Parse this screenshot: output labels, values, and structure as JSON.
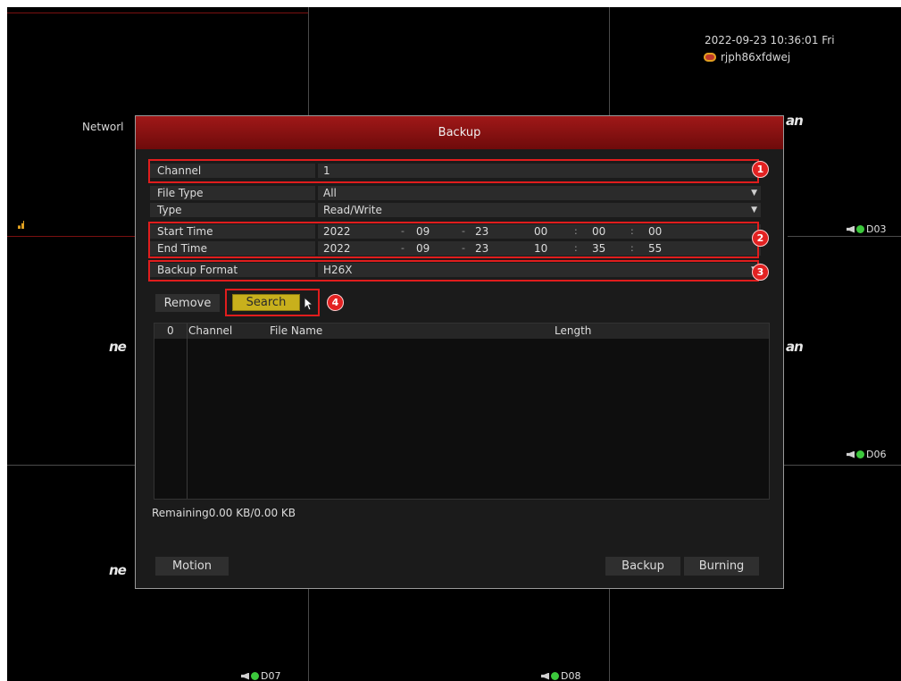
{
  "overlay": {
    "datetime": "2022-09-23 10:36:01 Fri",
    "device_id": "rjph86xfdwej"
  },
  "cameras": {
    "network_text": "Networl",
    "logo_text": "ne",
    "logo_text_right": "an",
    "channel_d03": "D03",
    "channel_d06": "D06",
    "channel_d07": "D07",
    "channel_d08": "D08"
  },
  "dialog": {
    "title": "Backup",
    "fields": {
      "channel": {
        "label": "Channel",
        "value": "1"
      },
      "file_type": {
        "label": "File Type",
        "value": "All"
      },
      "type": {
        "label": "Type",
        "value": "Read/Write"
      },
      "start_time": {
        "label": "Start Time",
        "year": "2022",
        "month": "09",
        "day": "23",
        "hour": "00",
        "minute": "00",
        "second": "00"
      },
      "end_time": {
        "label": "End Time",
        "year": "2022",
        "month": "09",
        "day": "23",
        "hour": "10",
        "minute": "35",
        "second": "55"
      },
      "backup_format": {
        "label": "Backup Format",
        "value": "H26X"
      }
    },
    "separators": {
      "date": "-",
      "time": ":"
    },
    "buttons": {
      "remove": "Remove",
      "search": "Search",
      "motion": "Motion",
      "backup": "Backup",
      "burning": "Burning"
    },
    "table": {
      "columns": [
        "0",
        "Channel",
        "File Name",
        "Length"
      ],
      "rows": []
    },
    "remaining": "Remaining0.00 KB/0.00 KB"
  },
  "annotations": {
    "badges": [
      "1",
      "2",
      "3",
      "4"
    ],
    "highlight_color": "#e01d1d"
  },
  "colors": {
    "title_bar": "#a01818",
    "search_button": "#c8b01c",
    "status_dot": "#3cc83c"
  },
  "icons": [
    "speaker-icon",
    "status-dot-icon",
    "cloud-user-icon",
    "signal-bars-icon",
    "cursor-pointer-icon",
    "dropdown-arrow-icon"
  ]
}
